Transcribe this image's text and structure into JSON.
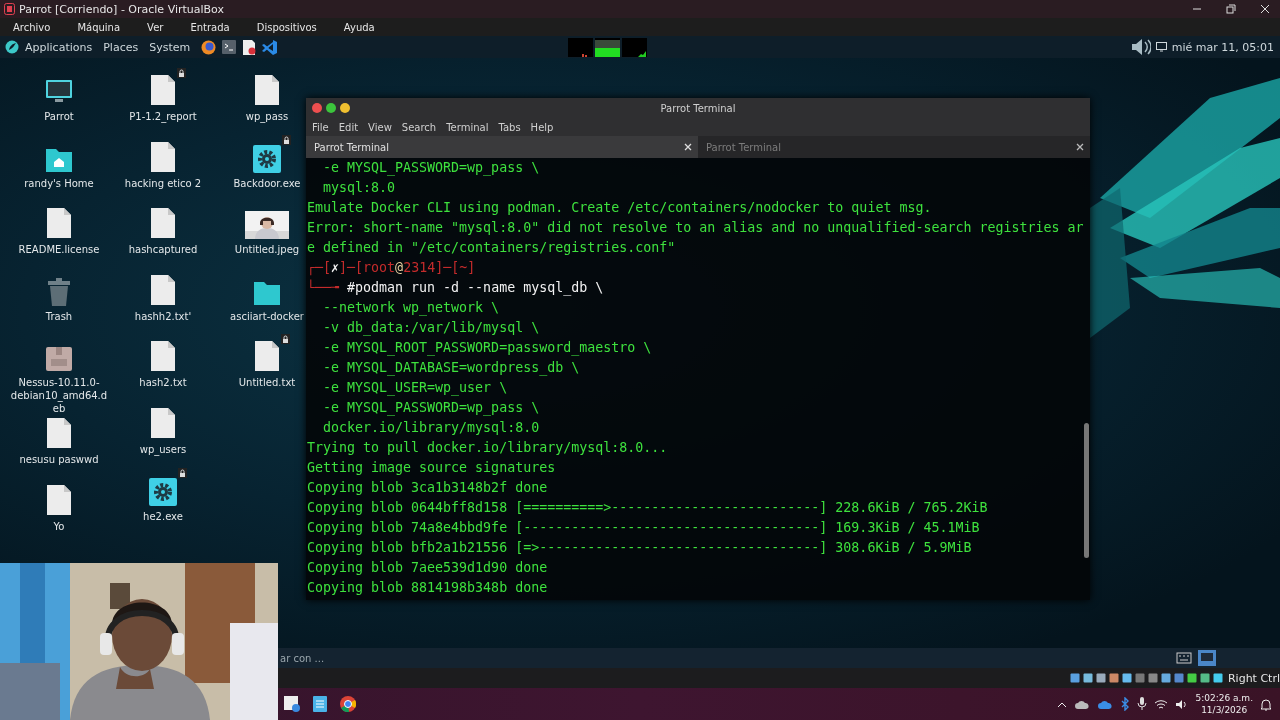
{
  "host_window": {
    "title": "Parrot [Corriendo] - Oracle VirtualBox",
    "menu": [
      "Archivo",
      "Máquina",
      "Ver",
      "Entrada",
      "Dispositivos",
      "Ayuda"
    ]
  },
  "panel": {
    "menus": [
      "Applications",
      "Places",
      "System"
    ],
    "clock": "mié mar 11, 05:01"
  },
  "desktop_columns": [
    {
      "items": [
        {
          "label": "Parrot",
          "kind": "monitor",
          "locked": false
        },
        {
          "label": "randy's Home",
          "kind": "home",
          "locked": false
        },
        {
          "label": "README.license",
          "kind": "file",
          "locked": false
        },
        {
          "label": "Trash",
          "kind": "trash",
          "locked": false
        },
        {
          "label": "Nessus-10.11.0-debian10_amd64.deb",
          "kind": "deb",
          "locked": false
        },
        {
          "label": "nesusu paswwd",
          "kind": "file",
          "locked": false
        },
        {
          "label": "Yo",
          "kind": "file",
          "locked": false
        }
      ]
    },
    {
      "items": [
        {
          "label": "P1-1.2_report",
          "kind": "file",
          "locked": true
        },
        {
          "label": "hacking etico 2",
          "kind": "file",
          "locked": false
        },
        {
          "label": "hashcaptured",
          "kind": "file",
          "locked": false
        },
        {
          "label": "hashh2.txt'",
          "kind": "file",
          "locked": false
        },
        {
          "label": "hash2.txt",
          "kind": "file",
          "locked": false
        },
        {
          "label": "wp_users",
          "kind": "file",
          "locked": false
        },
        {
          "label": "he2.exe",
          "kind": "gear",
          "locked": true
        }
      ]
    },
    {
      "items": [
        {
          "label": "wp_pass",
          "kind": "file",
          "locked": false
        },
        {
          "label": "Backdoor.exe",
          "kind": "gear",
          "locked": true
        },
        {
          "label": "Untitled.jpeg",
          "locked": false
        },
        {
          "label": "asciiart-docker",
          "kind": "folder",
          "locked": false
        },
        {
          "label": "Untitled.txt",
          "kind": "file",
          "locked": true
        }
      ]
    }
  ],
  "terminal": {
    "title": "Parrot Terminal",
    "menu": [
      "File",
      "Edit",
      "View",
      "Search",
      "Terminal",
      "Tabs",
      "Help"
    ],
    "tabs": [
      {
        "label": "Parrot Terminal",
        "selected": true
      },
      {
        "label": "Parrot Terminal",
        "selected": false
      }
    ],
    "lines": [
      {
        "kind": "output",
        "text": "  -e MYSQL_PASSWORD=wp_pass \\"
      },
      {
        "kind": "output",
        "text": "  mysql:8.0"
      },
      {
        "kind": "output",
        "text": "Emulate Docker CLI using podman. Create /etc/containers/nodocker to quiet msg."
      },
      {
        "kind": "output",
        "text": "Error: short-name \"mysql:8.0\" did not resolve to an alias and no unqualified-search registries ar"
      },
      {
        "kind": "output",
        "text": "e defined in \"/etc/containers/registries.conf\""
      },
      {
        "kind": "prompt",
        "segments": [
          {
            "kind": "frame",
            "text": "┌─["
          },
          {
            "kind": "mark",
            "text": "✗"
          },
          {
            "kind": "frame",
            "text": "]─["
          },
          {
            "kind": "user",
            "text": "root"
          },
          {
            "kind": "at",
            "text": "@"
          },
          {
            "kind": "user",
            "text": "2314"
          },
          {
            "kind": "frame",
            "text": "]─["
          },
          {
            "kind": "user",
            "text": "~"
          },
          {
            "kind": "frame",
            "text": "]"
          }
        ]
      },
      {
        "kind": "prompt",
        "segments": [
          {
            "kind": "frame",
            "text": "└──╼ "
          },
          {
            "kind": "command",
            "text": "#podman run -d --name mysql_db \\"
          }
        ]
      },
      {
        "kind": "output",
        "text": "  --network wp_network \\"
      },
      {
        "kind": "output",
        "text": "  -v db_data:/var/lib/mysql \\"
      },
      {
        "kind": "output",
        "text": "  -e MYSQL_ROOT_PASSWORD=password_maestro \\"
      },
      {
        "kind": "output",
        "text": "  -e MYSQL_DATABASE=wordpress_db \\"
      },
      {
        "kind": "output",
        "text": "  -e MYSQL_USER=wp_user \\"
      },
      {
        "kind": "output",
        "text": "  -e MYSQL_PASSWORD=wp_pass \\"
      },
      {
        "kind": "output",
        "text": "  docker.io/library/mysql:8.0"
      },
      {
        "kind": "output",
        "text": "Trying to pull docker.io/library/mysql:8.0..."
      },
      {
        "kind": "output",
        "text": "Getting image source signatures"
      },
      {
        "kind": "output",
        "text": "Copying blob 3ca1b3148b2f done"
      },
      {
        "kind": "output",
        "text": "Copying blob 0644bff8d158 [==========>--------------------------] 228.6KiB / 765.2KiB"
      },
      {
        "kind": "output",
        "text": "Copying blob 74a8e4bbd9fe [-------------------------------------] 169.3KiB / 45.1MiB"
      },
      {
        "kind": "output",
        "text": "Copying blob bfb2a1b21556 [=>-----------------------------------] 308.6KiB / 5.9MiB"
      },
      {
        "kind": "output",
        "text": "Copying blob 7aee539d1d90 done"
      },
      {
        "kind": "output",
        "text": "Copying blob 8814198b348b done"
      }
    ]
  },
  "vbox_status": {
    "hint": "ar con ...",
    "host_key": "Right Ctrl"
  },
  "taskbar": {
    "time": "5:02:26 a.m.",
    "date": "11/3/2026"
  }
}
